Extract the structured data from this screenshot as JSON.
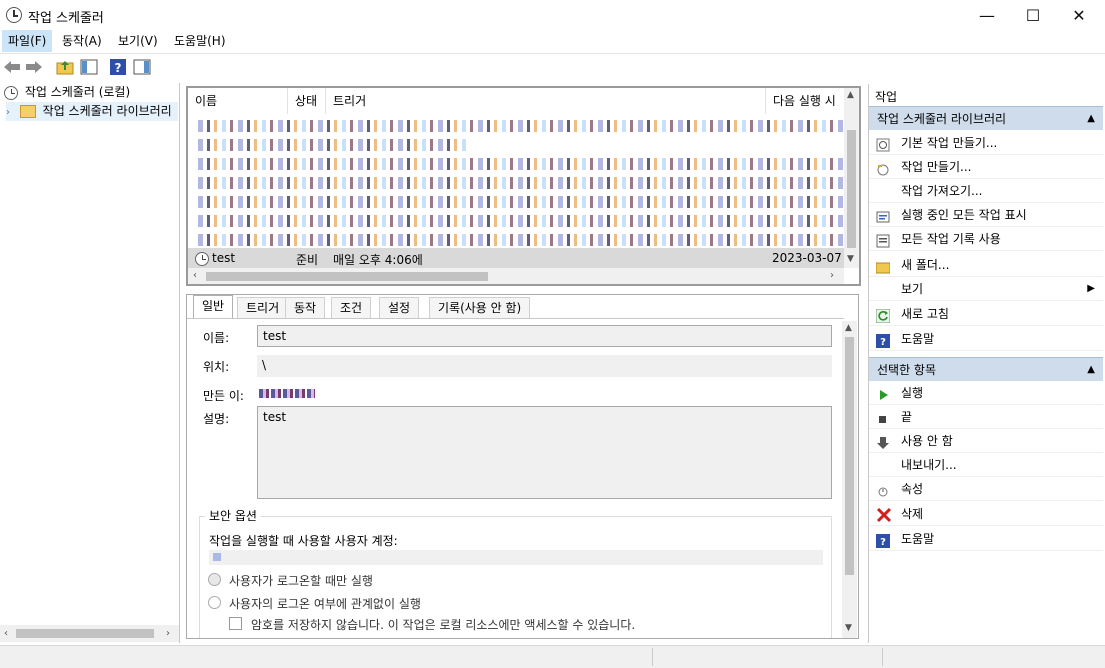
{
  "window": {
    "title": "작업 스케줄러"
  },
  "menu": [
    "파일(F)",
    "동작(A)",
    "보기(V)",
    "도움말(H)"
  ],
  "tree": {
    "root": "작업 스케줄러 (로컬)",
    "child": "작업 스케줄러 라이브러리"
  },
  "tasklist": {
    "columns": [
      "이름",
      "상태",
      "트리거",
      "다음 실행 시"
    ],
    "visible_task": {
      "name": "test",
      "status": "준비",
      "trigger": "매일 오후 4:06에",
      "next_run": "2023-03-07"
    }
  },
  "detail": {
    "tabs": [
      "일반",
      "트리거",
      "동작",
      "조건",
      "설정",
      "기록(사용 안 함)"
    ],
    "name_label": "이름:",
    "name_value": "test",
    "location_label": "위치:",
    "location_value": "\\",
    "author_label": "만든 이:",
    "description_label": "설명:",
    "description_value": "test",
    "security_title": "보안 옵션",
    "account_label": "작업을 실행할 때 사용할 사용자 계정:",
    "radio_logged_on": "사용자가 로그온할 때만 실행",
    "radio_any": "사용자의 로그온 여부에 관계없이 실행",
    "checkbox_no_password": "암호를 저장하지 않습니다. 이 작업은 로컬 리소스에만 액세스할 수 있습니다."
  },
  "actions": {
    "pane_title": "작업",
    "section1_title": "작업 스케줄러 라이브러리",
    "section1_items": [
      "기본 작업 만들기...",
      "작업 만들기...",
      "작업 가져오기...",
      "실행 중인 모든 작업 표시",
      "모든 작업 기록 사용",
      "새 폴더...",
      "보기",
      "새로 고침",
      "도움말"
    ],
    "section2_title": "선택한 항목",
    "section2_items": [
      "실행",
      "끝",
      "사용 안 함",
      "내보내기...",
      "속성",
      "삭제",
      "도움말"
    ]
  }
}
